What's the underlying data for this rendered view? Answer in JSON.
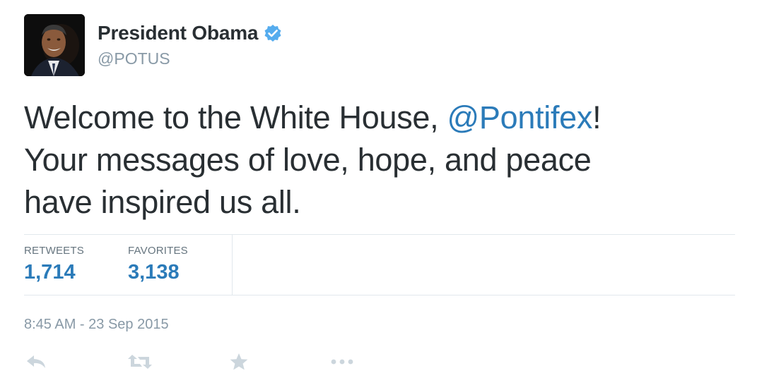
{
  "tweet": {
    "author": {
      "display_name": "President Obama",
      "handle": "@POTUS",
      "verified": true,
      "avatar": "avatar-photo"
    },
    "text": {
      "line1_before": "Welcome to the White House, ",
      "mention": "@Pontifex",
      "line1_after": "!",
      "line2": "Your messages of love, hope, and peace",
      "line3": "have inspired us all."
    },
    "stats": {
      "retweets_label": "RETWEETS",
      "retweets_value": "1,714",
      "favorites_label": "FAVORITES",
      "favorites_value": "3,138"
    },
    "timestamp": "8:45 AM - 23 Sep 2015",
    "actions": [
      {
        "name": "reply",
        "icon": "reply-icon"
      },
      {
        "name": "retweet",
        "icon": "retweet-icon"
      },
      {
        "name": "favorite",
        "icon": "star-icon"
      },
      {
        "name": "more",
        "icon": "more-icon"
      }
    ]
  },
  "colors": {
    "text": "#292f33",
    "muted": "#8899a6",
    "link": "#2b7bb9",
    "verified_badge": "#55acee",
    "divider": "#e1e8ed",
    "action_icon": "#ccd6dd"
  }
}
